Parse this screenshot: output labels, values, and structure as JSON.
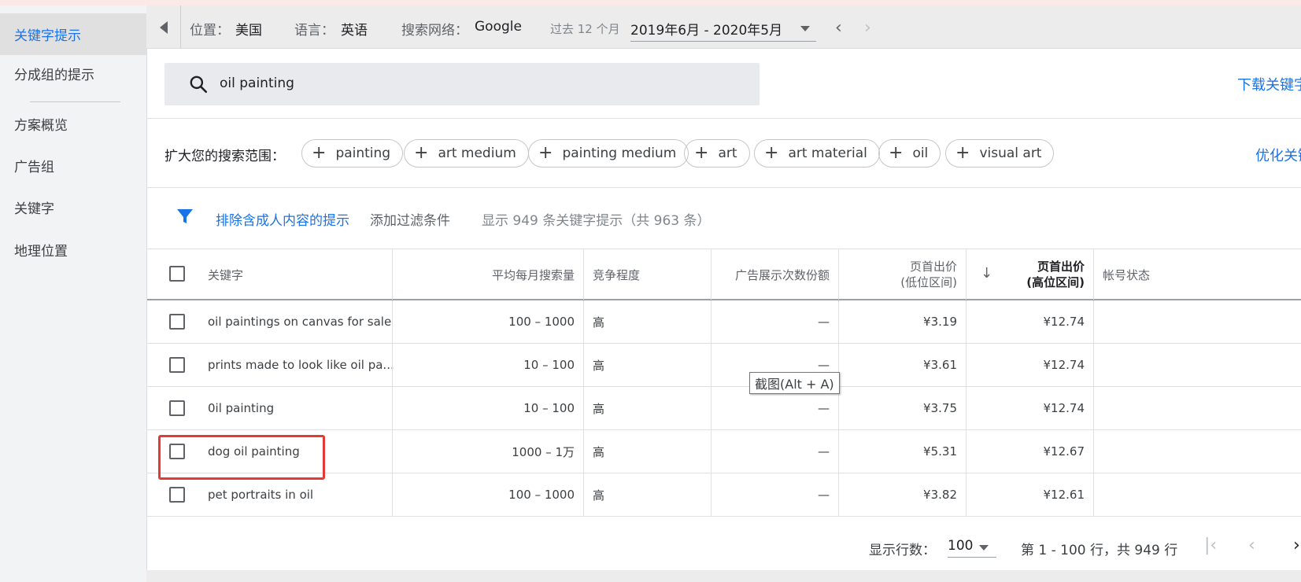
{
  "sidebar": {
    "items": [
      {
        "label": "关键字提示"
      },
      {
        "label": "分成组的提示"
      },
      {
        "label": "方案概览"
      },
      {
        "label": "广告组"
      },
      {
        "label": "关键字"
      },
      {
        "label": "地理位置"
      }
    ]
  },
  "topbar": {
    "location_label": "位置：",
    "location_value": "美国",
    "language_label": "语言：",
    "language_value": "英语",
    "network_label": "搜索网络：",
    "network_value": "Google",
    "period_label": "过去 12 个月",
    "date_range": "2019年6月 - 2020年5月"
  },
  "search": {
    "query": "oil painting",
    "download_link": "下载关键字"
  },
  "expand": {
    "label": "扩大您的搜索范围：",
    "chips": [
      "painting",
      "art medium",
      "painting medium",
      "art",
      "art material",
      "oil",
      "visual art"
    ],
    "refine_link": "优化关键字"
  },
  "filter": {
    "exclude_adult": "排除含成人内容的提示",
    "add_filter": "添加过滤条件",
    "count_text": "显示 949 条关键字提示（共 963 条）"
  },
  "table": {
    "headers": {
      "keyword": "关键字",
      "avg_searches": "平均每月搜索量",
      "competition": "竞争程度",
      "impression_share": "广告展示次数份额",
      "bid_low_1": "页首出价",
      "bid_low_2": "(低位区间)",
      "bid_high_1": "页首出价",
      "bid_high_2": "(高位区间)",
      "account_status": "帐号状态",
      "sort_icon": "arrow-down-icon"
    },
    "rows": [
      {
        "keyword": "oil paintings on canvas for sale",
        "searches": "100 – 1000",
        "competition": "高",
        "share": "—",
        "low": "¥3.19",
        "high": "¥12.74"
      },
      {
        "keyword": "prints made to look like oil pa...",
        "searches": "10 – 100",
        "competition": "高",
        "share": "—",
        "low": "¥3.61",
        "high": "¥12.74"
      },
      {
        "keyword": "0il painting",
        "searches": "10 – 100",
        "competition": "高",
        "share": "—",
        "low": "¥3.75",
        "high": "¥12.74"
      },
      {
        "keyword": "dog oil painting",
        "searches": "1000 – 1万",
        "competition": "高",
        "share": "—",
        "low": "¥5.31",
        "high": "¥12.67"
      },
      {
        "keyword": "pet portraits in oil",
        "searches": "100 – 1000",
        "competition": "高",
        "share": "—",
        "low": "¥3.82",
        "high": "¥12.61"
      }
    ]
  },
  "tooltip": {
    "text": "截图(Alt + A)"
  },
  "footer": {
    "rows_label": "显示行数：",
    "rows_value": "100",
    "range_text": "第 1 - 100 行，共 949 行"
  },
  "colors": {
    "accent": "#1a73e8",
    "highlight": "#e53935"
  }
}
